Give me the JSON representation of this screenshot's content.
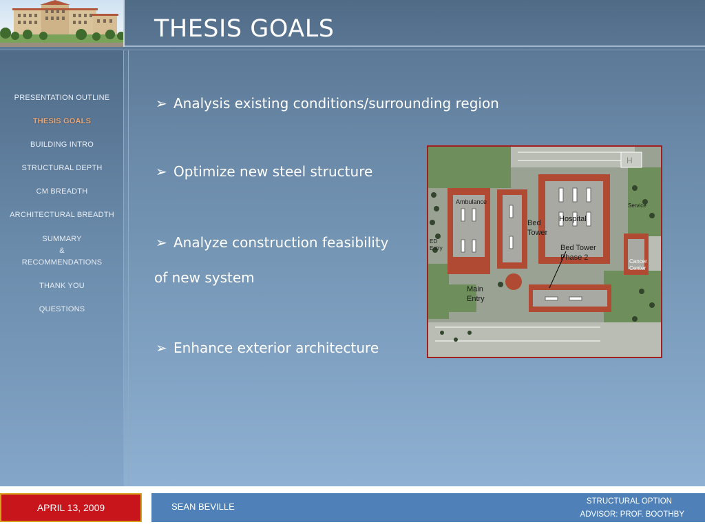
{
  "slide": {
    "title": "THESIS GOALS"
  },
  "sidebar": {
    "items": [
      {
        "label": "PRESENTATION OUTLINE"
      },
      {
        "label": "THESIS GOALS"
      },
      {
        "label": "BUILDING INTRO"
      },
      {
        "label": "STRUCTURAL DEPTH"
      },
      {
        "label": "CM BREADTH"
      },
      {
        "label": "ARCHITECTURAL BREADTH"
      },
      {
        "label": "SUMMARY"
      },
      {
        "label": "&"
      },
      {
        "label": "RECOMMENDATIONS"
      },
      {
        "label": "THANK YOU"
      },
      {
        "label": "QUESTIONS"
      }
    ]
  },
  "bullets": [
    {
      "text": "Analysis existing conditions/surrounding region"
    },
    {
      "text": "Optimize new steel structure"
    },
    {
      "text": "Analyze construction feasibility"
    },
    {
      "text": "of new system"
    },
    {
      "text": "Enhance exterior architecture"
    }
  ],
  "bullet_glyph": "➢",
  "site_plan": {
    "labels": {
      "ambulance": "Ambulance",
      "bed1": "Bed",
      "tower1": "Tower",
      "hospital": "Hospital",
      "bed_tower": "Bed Tower",
      "phase2": "Phase 2",
      "service": "Service",
      "cancer": "Cancer",
      "center": "Center",
      "main": "Main",
      "entry": "Entry",
      "ed": "ED",
      "ed_entry": "Entry"
    }
  },
  "footer": {
    "date": "APRIL 13, 2009",
    "name": "SEAN BEVILLE",
    "option": "STRUCTURAL OPTION",
    "advisor": "ADVISOR:  PROF. BOOTHBY"
  },
  "colors": {
    "accent_active": "#e9a878",
    "footer_red": "#c8141b",
    "footer_blue": "#4f81b8",
    "roof": "#b04a32"
  }
}
